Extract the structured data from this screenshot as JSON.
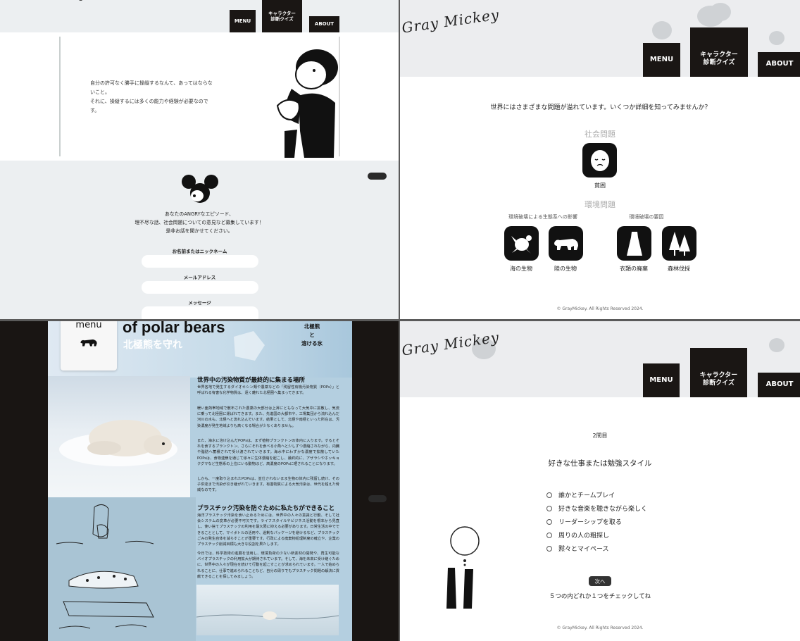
{
  "tl": {
    "nav": {
      "menu": "MENU",
      "quiz_line1": "キャラクター",
      "quiz_line2": "診断クイズ",
      "about": "ABOUT"
    },
    "quote_lines": [
      "自分の許可なく勝手に操縦するなんて、あってはならな",
      "いこと。",
      "それに、操縦するには多くの能力や経験が必要なので",
      "す。"
    ],
    "intro_lines": [
      "あなたのANGRYなエピソード、",
      "理不尽な話、社会問題についての意見など募集しています！",
      "是非お話を聞かせてください。"
    ],
    "form": {
      "name_label": "お名前またはニックネーム",
      "email_label": "メールアドレス",
      "message_label": "メッセージ"
    }
  },
  "tr": {
    "logo": "Gray Mickey",
    "nav": {
      "menu": "MENU",
      "quiz_line1": "キャラクター",
      "quiz_line2": "診断クイズ",
      "about": "ABOUT"
    },
    "lead": "世界にはさまざまな問題が溢れています。いくつか詳細を知ってみませんか？",
    "social_heading": "社会問題",
    "poverty": "貧困",
    "env_heading": "環境問題",
    "sub_ecosystem": "環境破壊による生態系への影響",
    "sub_causes": "環境破壊の要因",
    "sea": "海の生物",
    "land": "陸の生物",
    "clothes": "衣類の廃棄",
    "forest": "森林伐採",
    "footer": "© GrayMickey. All Rights Reserved 2024."
  },
  "bl": {
    "menu_label": "menu",
    "title_en": "of polar bears",
    "title_jp": "北極熊を守れ",
    "badge_line1": "北極熊",
    "badge_line2": "と",
    "badge_line3": "溶ける氷",
    "h1": "世界中の汚染物質が最終的に集まる場所",
    "p1": "世界各地で発生するダイオキシン類や農薬などの「残留性有機汚染物質（POPs）」と呼ばれる有害な化学物質は、遠く離れた北極圏へ集まってきます。",
    "p2": "暖い亜熱帯地域で散布された農薬の大部分は上昇にともなって大気中に拡散し、気流に乗って北極圏に運ばれてきます。また、先進国の大都市や、工場集団から流れ込んだ河川の水も、北極へと流れ込んでいます。結果として、北極や南極といった所在は、汚染濃度が発生地域よりも高くなる場合が少なくありません。",
    "p3": "また、海水に溶け込んだPOPsは、まず植物プランクトンの体内に入ります。するとそれを食するプランクトン、さらにそれを食べる小魚へと少しずつ濃縮されながら、内臓や脂肪へ蓄積されて受け渡されていきます。海水中にわずかな濃度で拡散していたPOPsは、食物連鎖を通じて徐々に生体濃縮を起こし、最終的に、アザラシやホッキョクグマなど生態系の上位にいる動物ほど、高濃度のPOPsに晒されることになります。",
    "p4": "しかも、一度取り込まれたPOPsは、並仕されないまま生物の体内に残留し続け、その子供達まで汚染が引き継がれていきます。有害物質による大気汚染は、世代を超えた脅威なのです。",
    "h2": "プラスチック汚染を防ぐために私たちができること",
    "p5": "海洋プラスチック汚染を食い止めるためには、世界中の人々の意識と行動、そして社会システムの変革が必要不可欠です。ライフスタイルやビジネス活動を根本から見直し、使い捨てプラスチックの利用を最大限に抑える必要があります。日常生活の中でできることとして、マイボトルの活用や、過剰なパッケージを避けるなど、プラスチックごみの発生自体を減らすことが重要です。行政による廃棄物処理制度の確立や、企業のプラスチック削減目標も大きな役割を果たします。",
    "p6": "今日では、科学技術の進展を活用し、環境負荷の少ない新素材の開発や、再生可能なバイオプラスチックの利用拡大が期待されています。そして、海を未来に受け継ぐために、世界中の人々が現在を続けて行動を起こすことが求められています。一人で始められることに、仕事で進められることなど、自分の周りでもプラスチック問題の解決に貢献できることを探してみましょう。"
  },
  "br": {
    "logo": "Gray Mickey",
    "nav": {
      "menu": "MENU",
      "quiz_line1": "キャラクター",
      "quiz_line2": "診断クイズ",
      "about": "ABOUT"
    },
    "question_number": "2問目",
    "question": "好きな仕事または勉強スタイル",
    "options": [
      "誰かとチームプレイ",
      "好きな音楽を聴きながら楽しく",
      "リーダーシップを取る",
      "周りの人の粗探し",
      "黙々とマイペース"
    ],
    "next": "次へ",
    "hint": "５つの内どれか１つをチェックしてね",
    "footer": "© GrayMickey. All Rights Reserved 2024."
  }
}
